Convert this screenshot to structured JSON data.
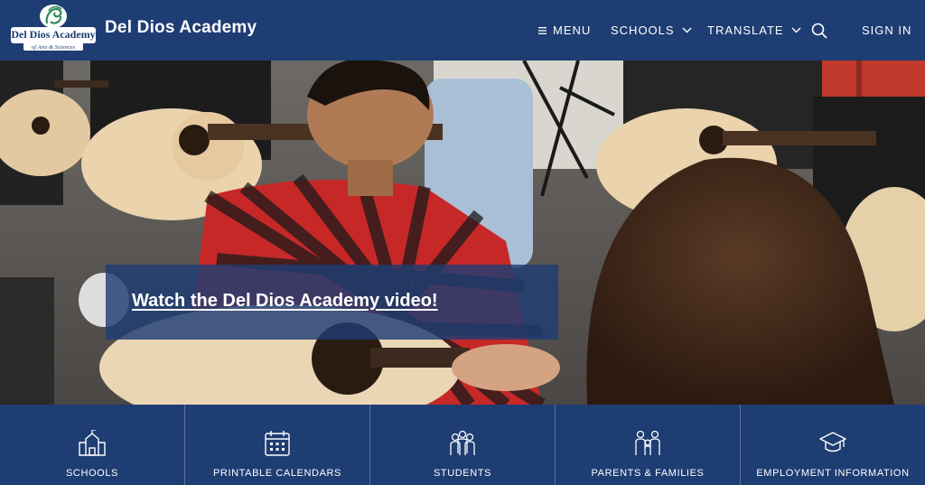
{
  "header": {
    "logo_text": "Del Dios Academy of Arts & Sciences",
    "site_title": "Del Dios Academy",
    "nav": {
      "menu": "MENU",
      "schools": "SCHOOLS",
      "translate": "TRANSLATE",
      "sign_in": "SIGN IN"
    }
  },
  "hero": {
    "video_link": "Watch the Del Dios Academy video!"
  },
  "quick_links": [
    {
      "label": "SCHOOLS",
      "icon": "school-building-icon"
    },
    {
      "label": "PRINTABLE CALENDARS",
      "icon": "calendar-icon"
    },
    {
      "label": "STUDENTS",
      "icon": "students-group-icon"
    },
    {
      "label": "PARENTS & FAMILIES",
      "icon": "family-icon"
    },
    {
      "label": "EMPLOYMENT INFORMATION",
      "icon": "graduation-cap-icon"
    }
  ],
  "colors": {
    "primary": "#1e3d73",
    "logo_green": "#2e8b57"
  }
}
